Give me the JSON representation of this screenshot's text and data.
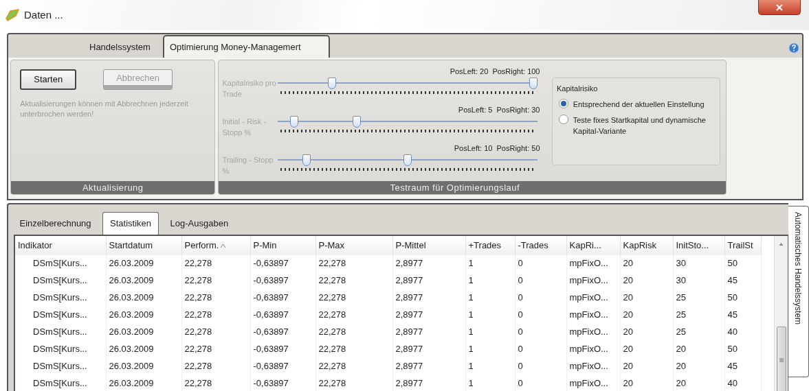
{
  "window": {
    "title": "Daten ..."
  },
  "top_tabs": [
    {
      "label": "Handelssystem",
      "selected": false
    },
    {
      "label": "Optimierung Money-Managemert",
      "selected": true
    }
  ],
  "update_group": {
    "buttons": [
      {
        "label": "Starten",
        "disabled": false
      },
      {
        "label": "Abbrechen",
        "disabled": true
      }
    ],
    "hint": "Aktualisierungen können mit Abbrechnen jederzeit unterbrochen werden!",
    "footer": "Aktualisierung"
  },
  "test_group": {
    "sliders": [
      {
        "label": "Kapitalrisiko pro Trade",
        "reading": "PosLeft: 20  PosRight: 100",
        "thumbs": [
          {
            "level": 0.2
          },
          {
            "level": 1
          }
        ]
      },
      {
        "label": "Initial - Risk - Stopp %",
        "reading": "PosLeft: 5  PosRight: 30",
        "thumbs": [
          {
            "level": 0.05
          },
          {
            "level": 0.3
          }
        ]
      },
      {
        "label": "Trailing - Stopp %",
        "reading": "PosLeft: 10  PosRight: 50",
        "thumbs": [
          {
            "level": 0.1
          },
          {
            "level": 0.5
          }
        ]
      }
    ],
    "radio_group": {
      "title": "Kapitalrisiko",
      "options": [
        {
          "label": "Entsprechend der aktuellen Einstellung",
          "selected": true
        },
        {
          "label": "Teste fixes Startkapital und dynamische Kapital-Variante",
          "selected": false
        }
      ]
    },
    "footer": "Testraum für Optimierungslauf"
  },
  "bottom_tabs": [
    {
      "label": "Einzelberechnung",
      "selected": false
    },
    {
      "label": "Statistiken",
      "selected": true
    },
    {
      "label": "Log-Ausgaben",
      "selected": false
    }
  ],
  "table": {
    "columns": [
      {
        "label": "Indikator",
        "sorted": false
      },
      {
        "label": "Startdatum",
        "sorted": false
      },
      {
        "label": "Perform.",
        "sorted": true
      },
      {
        "label": "P-Min",
        "sorted": false
      },
      {
        "label": "P-Max",
        "sorted": false
      },
      {
        "label": "P-Mittel",
        "sorted": false
      },
      {
        "label": "+Trades",
        "sorted": false
      },
      {
        "label": "-Trades",
        "sorted": false
      },
      {
        "label": "KapRi...",
        "sorted": false
      },
      {
        "label": "KapRisk",
        "sorted": false
      },
      {
        "label": "InitSto...",
        "sorted": false
      },
      {
        "label": "TrailSt",
        "sorted": false
      }
    ],
    "rows": [
      [
        "DSmS[Kurs...",
        "26.03.2009",
        "22,278",
        "-0,63897",
        "22,278",
        "2,8977",
        "1",
        "0",
        "mpFixO...",
        "20",
        "30",
        "50"
      ],
      [
        "DSmS[Kurs...",
        "26.03.2009",
        "22,278",
        "-0,63897",
        "22,278",
        "2,8977",
        "1",
        "0",
        "mpFixO...",
        "20",
        "30",
        "45"
      ],
      [
        "DSmS[Kurs...",
        "26.03.2009",
        "22,278",
        "-0,63897",
        "22,278",
        "2,8977",
        "1",
        "0",
        "mpFixO...",
        "20",
        "25",
        "50"
      ],
      [
        "DSmS[Kurs...",
        "26.03.2009",
        "22,278",
        "-0,63897",
        "22,278",
        "2,8977",
        "1",
        "0",
        "mpFixO...",
        "20",
        "25",
        "45"
      ],
      [
        "DSmS[Kurs...",
        "26.03.2009",
        "22,278",
        "-0,63897",
        "22,278",
        "2,8977",
        "1",
        "0",
        "mpFixO...",
        "20",
        "25",
        "40"
      ],
      [
        "DSmS[Kurs...",
        "26.03.2009",
        "22,278",
        "-0,63897",
        "22,278",
        "2,8977",
        "1",
        "0",
        "mpFixO...",
        "20",
        "20",
        "50"
      ],
      [
        "DSmS[Kurs...",
        "26.03.2009",
        "22,278",
        "-0,63897",
        "22,278",
        "2,8977",
        "1",
        "0",
        "mpFixO...",
        "20",
        "20",
        "45"
      ],
      [
        "DSmS[Kurs...",
        "26.03.2009",
        "22,278",
        "-0,63897",
        "22,278",
        "2,8977",
        "1",
        "0",
        "mpFixO...",
        "20",
        "20",
        "40"
      ]
    ]
  },
  "side_tab": {
    "label": "Automatisches Handelssystem"
  }
}
